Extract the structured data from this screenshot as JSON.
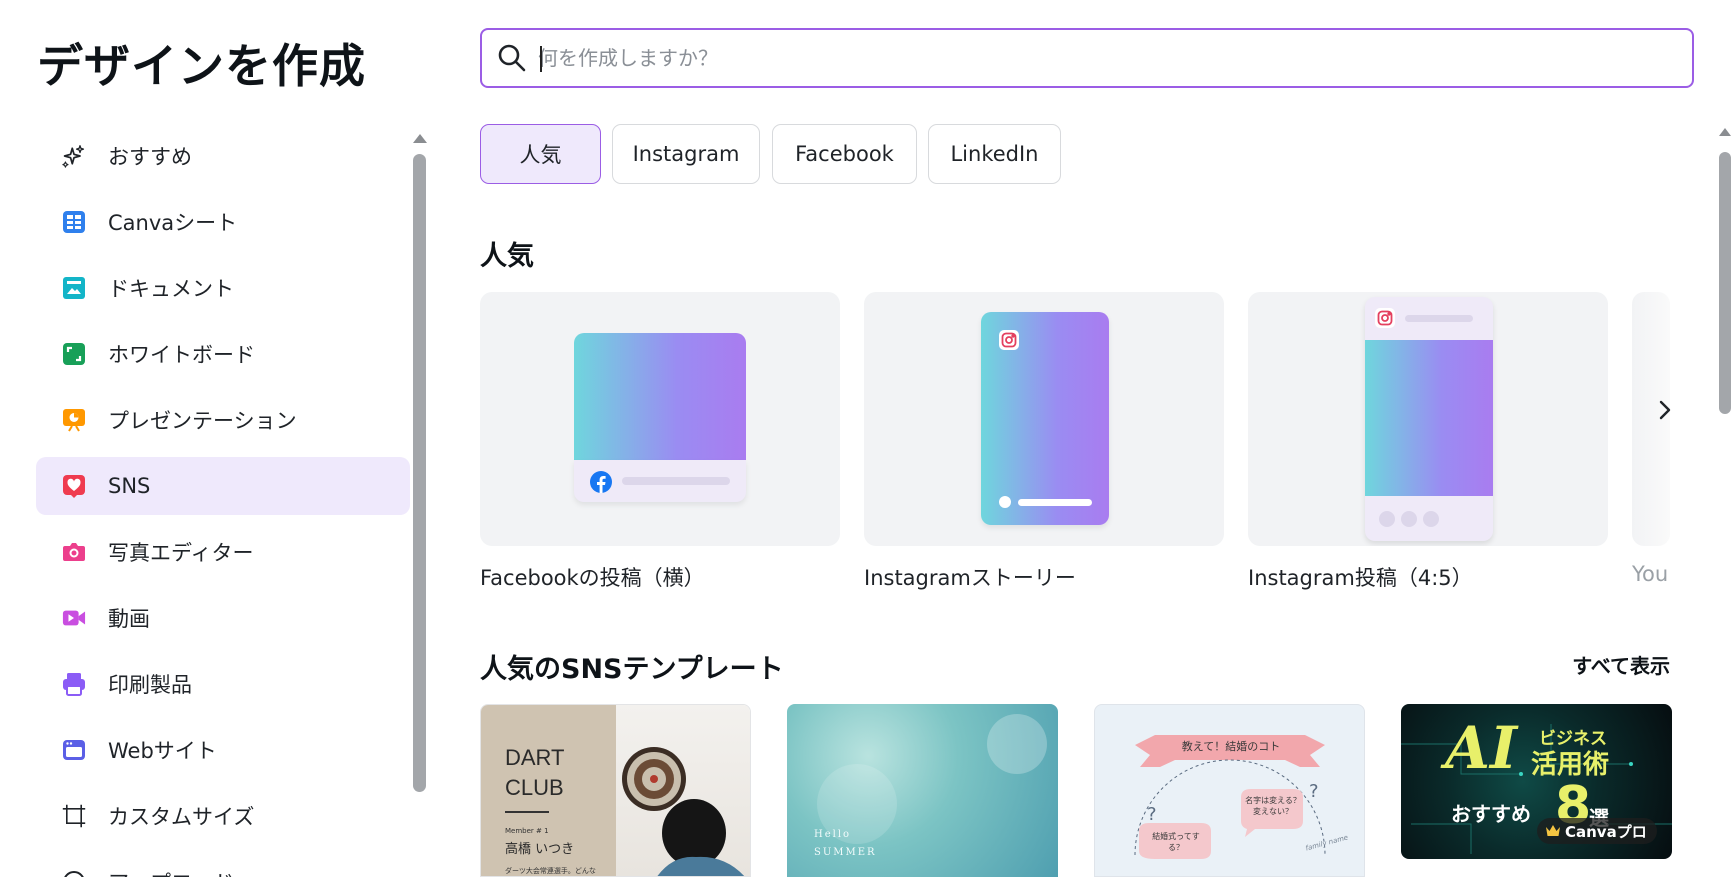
{
  "page_title": "デザインを作成",
  "search": {
    "placeholder": "何を作成しますか？"
  },
  "sidebar": {
    "items": [
      {
        "label": "おすすめ",
        "icon": "sparkle-icon",
        "color": "#1f2328"
      },
      {
        "label": "Canvaシート",
        "icon": "sheet-icon",
        "color": "#2f80ed"
      },
      {
        "label": "ドキュメント",
        "icon": "document-icon",
        "color": "#13b5c8"
      },
      {
        "label": "ホワイトボード",
        "icon": "whiteboard-icon",
        "color": "#18a058"
      },
      {
        "label": "プレゼンテーション",
        "icon": "presentation-icon",
        "color": "#ff9800"
      },
      {
        "label": "SNS",
        "icon": "heart-icon",
        "color": "#ef3b4f",
        "active": true
      },
      {
        "label": "写真エディター",
        "icon": "camera-icon",
        "color": "#ec3f8c"
      },
      {
        "label": "動画",
        "icon": "video-icon",
        "color": "#c94ee0"
      },
      {
        "label": "印刷製品",
        "icon": "printer-icon",
        "color": "#8b5cf6"
      },
      {
        "label": "Webサイト",
        "icon": "website-icon",
        "color": "#5b5fe6"
      },
      {
        "label": "カスタムサイズ",
        "icon": "custom-size-icon",
        "color": "#1f2328"
      },
      {
        "label": "アップロード",
        "icon": "upload-icon",
        "color": "#1f2328"
      }
    ]
  },
  "chips": [
    {
      "label": "人気",
      "active": true
    },
    {
      "label": "Instagram"
    },
    {
      "label": "Facebook"
    },
    {
      "label": "LinkedIn"
    }
  ],
  "popular": {
    "heading": "人気",
    "cards": [
      {
        "label": "Facebookの投稿（横）"
      },
      {
        "label": "Instagramストーリー"
      },
      {
        "label": "Instagram投稿（4:5）"
      },
      {
        "label": "You"
      }
    ]
  },
  "templates": {
    "heading": "人気のSNSテンプレート",
    "see_all": "すべて表示",
    "dart": {
      "title_line1": "DART",
      "title_line2": "CLUB",
      "member": "Member # 1",
      "name": "高橋 いつき",
      "caption": "ダーツ大会常連選手。どんな"
    },
    "summer": {
      "line1": "Hello",
      "line2": "SUMMER"
    },
    "wedding": {
      "banner": "教えて！結婚のコト",
      "bubble1": "名字は変える？変えない？",
      "bubble2": "結婚式ってする？",
      "sign": "family name"
    },
    "ai": {
      "big": "AI",
      "line1": "ビジネス",
      "line2": "活用術",
      "line3": "おすすめ",
      "num": "8",
      "sen": "選",
      "badge": "Canvaプロ"
    }
  },
  "colors": {
    "accent": "#9b5de5",
    "active_bg": "#efe9fc"
  }
}
